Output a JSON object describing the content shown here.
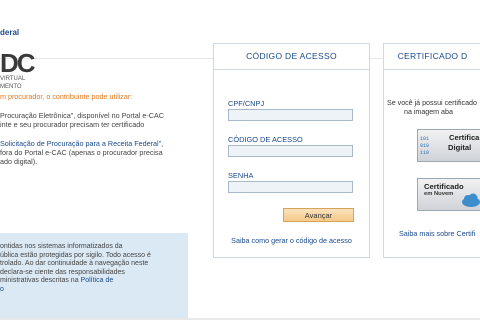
{
  "header": {
    "gov_label": "deral"
  },
  "logo": {
    "big": "DC",
    "line1": "VIRTUAL",
    "line2": "MENTO"
  },
  "left": {
    "intro": "m procurador, o contribuinte pode utilizar:",
    "option1": [
      "Procuração Eletrônica\", disponível no Portal e-CAC",
      "inte e seu procurador precisam ter certificado"
    ],
    "option2": [
      "Solicitação de Procuração para a Receita Federal\",",
      "fora do Portal e-CAC (apenas o procurador precisa",
      "ado digital)."
    ]
  },
  "notice": {
    "lines": [
      "ontidas nos sistemas informatizados da",
      "ública estão protegidas por sigilo. Todo acesso é",
      "trolado. Ao dar continuidade à navegação neste",
      " declara-se ciente das responsabilidades",
      "ministrativas descritas na"
    ],
    "link1": "Política de",
    "link2": "o"
  },
  "acesso": {
    "title": "CÓDIGO DE ACESSO",
    "cpf_label": "CPF/CNPJ",
    "cpf_value": "",
    "codigo_label": "CÓDIGO DE ACESSO",
    "codigo_value": "",
    "senha_label": "SENHA",
    "senha_value": "",
    "submit": "Avançar",
    "help": "Saiba como gerar o código de acesso"
  },
  "certificado": {
    "title": "CERTIFICADO D",
    "text_line1": "Se você já possui certificado",
    "text_line2": "na imagem aba",
    "card1_line1": "Certifica",
    "card1_line2": "Digital",
    "card2_line1": "Certificado",
    "card2_line2": "em Nuvem",
    "link": "Saiba mais sobre Certifi"
  }
}
